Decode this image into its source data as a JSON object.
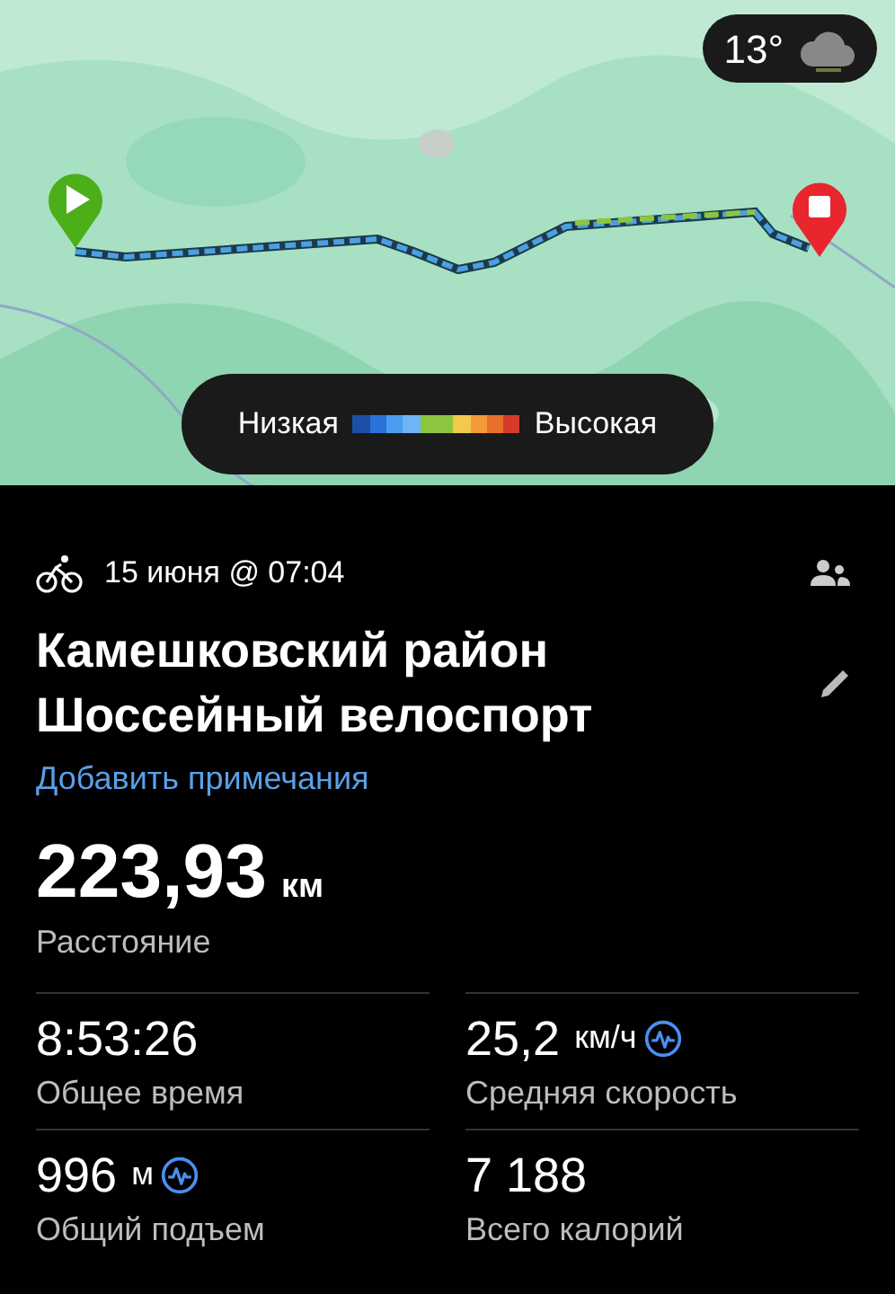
{
  "map": {
    "weather": {
      "temperature": "13°"
    },
    "legend": {
      "low": "Низкая",
      "high": "Высокая"
    }
  },
  "activity": {
    "date": "15 июня @ 07:04",
    "title_lines": [
      "Камешковский район",
      "Шоссейный велоспорт"
    ],
    "add_notes": "Добавить примечания"
  },
  "distance": {
    "value": "223,93",
    "unit": "км",
    "label": "Расстояние"
  },
  "stats": [
    {
      "value": "8:53:26",
      "label": "Общее время",
      "chart_link": false
    },
    {
      "value": "25,2",
      "unit": "км/ч",
      "label": "Средняя скорость",
      "chart_link": true
    },
    {
      "value": "996",
      "unit": "м",
      "label": "Общий подъем",
      "chart_link": true
    },
    {
      "value": "7 188",
      "label": "Всего калорий",
      "chart_link": false
    }
  ]
}
